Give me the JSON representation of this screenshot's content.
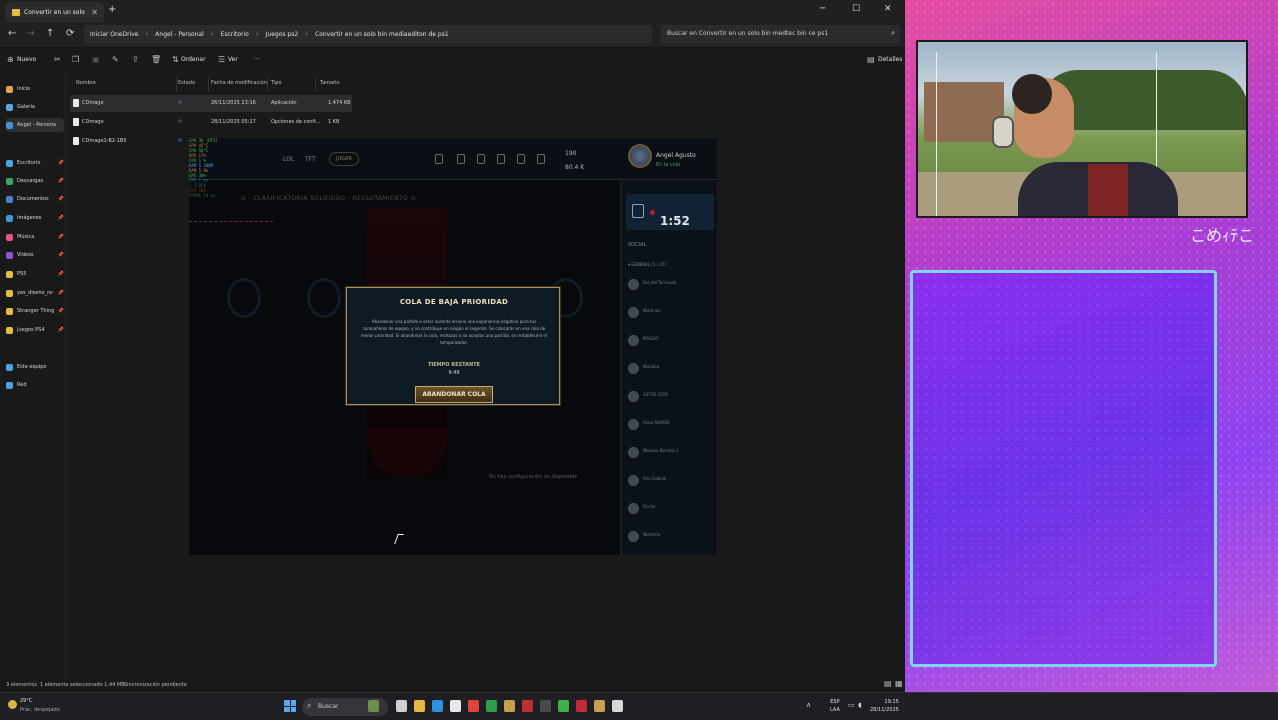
{
  "explorer": {
    "tab_title": "Convertir en un solo bin mod",
    "tab_add": "+",
    "window_controls": [
      "─",
      "☐",
      "✕"
    ],
    "nav": {
      "back": "←",
      "forward": "→",
      "up": "↑",
      "refresh": "⟳"
    },
    "breadcrumbs": [
      "Iniciar OneDrive",
      "Angel - Personal",
      "Escritorio",
      "Juegos ps2",
      "Convertir en un solo bin mediaediton de ps1"
    ],
    "search_placeholder": "Buscar en Convertir en un solo bin medtec bin ce ps1",
    "toolbar": {
      "new": "Nuevo",
      "sort": "Ordenar",
      "view": "Ver",
      "more": "···",
      "details": "Detalles"
    },
    "sidebar": [
      {
        "label": "Inicio",
        "color": "#e0a34a",
        "pinned": false
      },
      {
        "label": "Galería",
        "color": "#58a6e6",
        "pinned": false
      },
      {
        "label": "Angel - Persona",
        "color": "#4a90d9",
        "pinned": false,
        "selected": true
      },
      {
        "label": "Escritorio",
        "color": "#4ea4e0",
        "pinned": true
      },
      {
        "label": "Descargas",
        "color": "#3fa55c",
        "pinned": true
      },
      {
        "label": "Documentos",
        "color": "#4d7fd1",
        "pinned": true
      },
      {
        "label": "Imágenes",
        "color": "#3a9ad8",
        "pinned": true
      },
      {
        "label": "Música",
        "color": "#e0558a",
        "pinned": true
      },
      {
        "label": "Videos",
        "color": "#8a56d6",
        "pinned": true
      },
      {
        "label": "PS5",
        "color": "#e6b844",
        "pinned": true
      },
      {
        "label": "yes_diseño_re-P",
        "color": "#e6b844",
        "pinned": true
      },
      {
        "label": "Stranger Things",
        "color": "#e6b844",
        "pinned": true
      },
      {
        "label": "Juegos PS4",
        "color": "#e6b844",
        "pinned": true
      },
      {
        "label": "Este equipo",
        "color": "#4ea4e0",
        "pinned": false
      },
      {
        "label": "Red",
        "color": "#4ea4e0",
        "pinned": false
      }
    ],
    "columns": [
      "Nombre",
      "Estado",
      "Fecha de modificación",
      "Tipo",
      "Tamaño"
    ],
    "files": [
      {
        "name": "CDmage",
        "status": "⟳",
        "date": "26/11/2025 23:16",
        "type": "Aplicación",
        "size": "1.474 KB",
        "selected": true
      },
      {
        "name": "CDmage",
        "status": "⟳",
        "date": "28/11/2025 05:27",
        "type": "Opciones de confi...",
        "size": "1 KB"
      },
      {
        "name": "CDmage1-B2-1B5",
        "status": "⟳",
        "date": "",
        "type": "",
        "size": ""
      }
    ],
    "status": {
      "count": "3 elementos",
      "selection": "1 elemento seleccionado  1,44 MB",
      "sync": "Sincronización pendiente"
    }
  },
  "game": {
    "tabs": [
      "LOL",
      "TFT"
    ],
    "play_label": "JUGAR",
    "currency": {
      "rp": "190",
      "be": "80.4 K"
    },
    "player": {
      "name": "Angel Agusto",
      "status": "En la cola"
    },
    "fps_lines": [
      "GPU 30 (RTX)",
      "GPU  45°C",
      "CPU  58°C",
      "GPU  17%",
      "CPU  1 %",
      "RAM  5 200M",
      "RAM  5 8%",
      "GPU  30%",
      "FPS  1 ms",
      "1 CLOCK",
      "FPS  105",
      "FRAME 10 ms"
    ],
    "fps_colors": [
      "#3fbf4f",
      "#e07a2a",
      "#3fbf4f",
      "#e07a2a",
      "#3fbf4f",
      "#4aa0e0",
      "#e07a2a",
      "#3fbf4f",
      "#4aa0e0",
      "#4aa0e0",
      "#e07a2a",
      "#3fbf4f"
    ],
    "queue_title": "⊙ · CLASIFICATORIA SOLO/DÚO - RECLUTAMIENTO  ⊙",
    "modal": {
      "title": "COLA DE BAJA PRIORIDAD",
      "body": "Abandonar una partida o estar ausente arruina una experiencia negativa para tus compañeros de equipo, y no contribuye en ningún el Legends. Se colocarás en una cola de menor prioridad. Si abandonas la cola, rechazas o no aceptas una partida, se restablecerá el temporizador.",
      "time_label": "TIEMPO RESTANTE",
      "time_value": "9:49",
      "button": "ABANDONAR COLA"
    },
    "social": {
      "timer": "1:52",
      "header": "SOCIAL",
      "group": "▾ GENERAL (1 / 37)",
      "friends": [
        "Dio del Terrsuelo",
        "Martinez",
        "MAGIA5",
        "Maraiba",
        "ASTOS 2026",
        "Aviso NAMOR",
        "Monaco Benitez 1",
        "Ana Gabriel",
        "Flo-ler",
        "Nietzche"
      ]
    },
    "footer": "No hay configuración no disponible"
  },
  "overlay": {
    "caption": "こめｨﾃこ"
  },
  "taskbar": {
    "weather_temp": "29°C",
    "weather_desc": "Prac. despejado",
    "search": "Buscar",
    "lang_top": "ESP",
    "lang_bottom": "LAA",
    "time": "19:15",
    "date": "28/11/2025"
  }
}
